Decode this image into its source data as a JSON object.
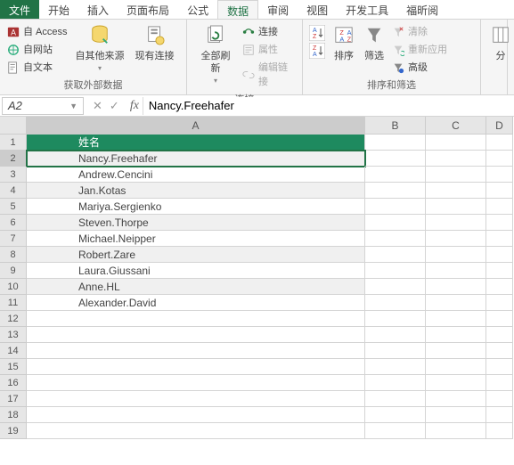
{
  "tabs": {
    "file": "文件",
    "home": "开始",
    "insert": "插入",
    "layout": "页面布局",
    "formula": "公式",
    "data": "数据",
    "review": "审阅",
    "view": "视图",
    "dev": "开发工具",
    "foxit": "福昕阅"
  },
  "ribbon": {
    "external": {
      "access": "自 Access",
      "web": "自网站",
      "text": "自文本",
      "other": "自其他来源",
      "existing": "现有连接",
      "label": "获取外部数据"
    },
    "conn": {
      "refresh": "全部刷新",
      "connections": "连接",
      "properties": "属性",
      "editlinks": "编辑链接",
      "label": "连接"
    },
    "sort": {
      "sort": "排序",
      "filter": "筛选",
      "clear": "清除",
      "reapply": "重新应用",
      "advanced": "高级",
      "label": "排序和筛选"
    },
    "tools": {
      "col": "分"
    }
  },
  "namebox": "A2",
  "formula": "Nancy.Freehafer",
  "columns": [
    "A",
    "B",
    "C",
    "D"
  ],
  "table": {
    "header": "姓名",
    "rows": [
      "Nancy.Freehafer",
      "Andrew.Cencini",
      "Jan.Kotas",
      "Mariya.Sergienko",
      "Steven.Thorpe",
      "Michael.Neipper",
      "Robert.Zare",
      "Laura.Giussani",
      "Anne.HL",
      "Alexander.David"
    ]
  },
  "rownums": [
    "1",
    "2",
    "3",
    "4",
    "5",
    "6",
    "7",
    "8",
    "9",
    "10",
    "11",
    "12",
    "13",
    "14",
    "15",
    "16",
    "17",
    "18",
    "19"
  ]
}
